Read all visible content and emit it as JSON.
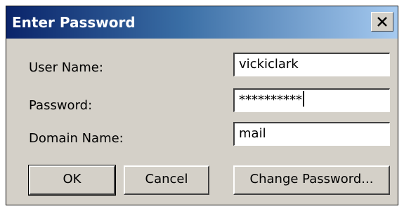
{
  "window": {
    "title": "Enter Password"
  },
  "form": {
    "user_name_label": "User Name:",
    "user_name_value": "vickiclark",
    "password_label": "Password:",
    "password_value": "**********",
    "domain_label": "Domain Name:",
    "domain_value": "mail"
  },
  "buttons": {
    "ok": "OK",
    "cancel": "Cancel",
    "change_password": "Change Password..."
  },
  "colors": {
    "title_gradient_start": "#0a246a",
    "title_gradient_end": "#a6caf0",
    "dialog_face": "#d4d0c8"
  },
  "icons": {
    "close": "close-icon"
  }
}
